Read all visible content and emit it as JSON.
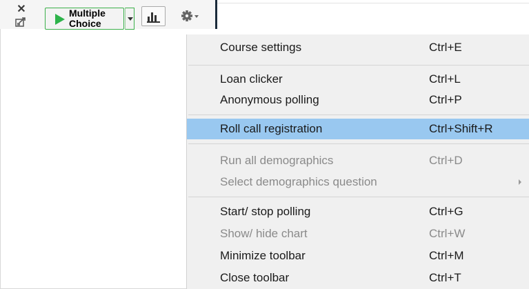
{
  "toolbar": {
    "close_glyph": "✕",
    "question_type_label": "Multiple\nChoice",
    "colors": {
      "start_button_border": "#3bb04a",
      "play_icon": "#2db34a",
      "menu_highlight": "#99c8f0"
    }
  },
  "menu": {
    "items": [
      {
        "label": "Course settings",
        "shortcut": "Ctrl+E",
        "disabled": false,
        "highlighted": false
      },
      {
        "label": "Loan clicker",
        "shortcut": "Ctrl+L",
        "disabled": false,
        "highlighted": false
      },
      {
        "label": "Anonymous polling",
        "shortcut": "Ctrl+P",
        "disabled": false,
        "highlighted": false
      },
      {
        "label": "Roll call registration",
        "shortcut": "Ctrl+Shift+R",
        "disabled": false,
        "highlighted": true
      },
      {
        "label": "Run all demographics",
        "shortcut": "Ctrl+D",
        "disabled": true,
        "highlighted": false
      },
      {
        "label": "Select demographics question",
        "shortcut": "",
        "disabled": true,
        "highlighted": false,
        "submenu": true
      },
      {
        "label": "Start/ stop polling",
        "shortcut": "Ctrl+G",
        "disabled": false,
        "highlighted": false
      },
      {
        "label": "Show/ hide chart",
        "shortcut": "Ctrl+W",
        "disabled": true,
        "highlighted": false
      },
      {
        "label": "Minimize toolbar",
        "shortcut": "Ctrl+M",
        "disabled": false,
        "highlighted": false
      },
      {
        "label": "Close toolbar",
        "shortcut": "Ctrl+T",
        "disabled": false,
        "highlighted": false
      }
    ]
  },
  "icons": {
    "close": "close-icon",
    "export": "export-icon",
    "play": "play-icon",
    "dropdown": "chevron-down-icon",
    "chart": "bar-chart-icon",
    "settings": "gear-icon",
    "submenu": "chevron-right-icon"
  }
}
